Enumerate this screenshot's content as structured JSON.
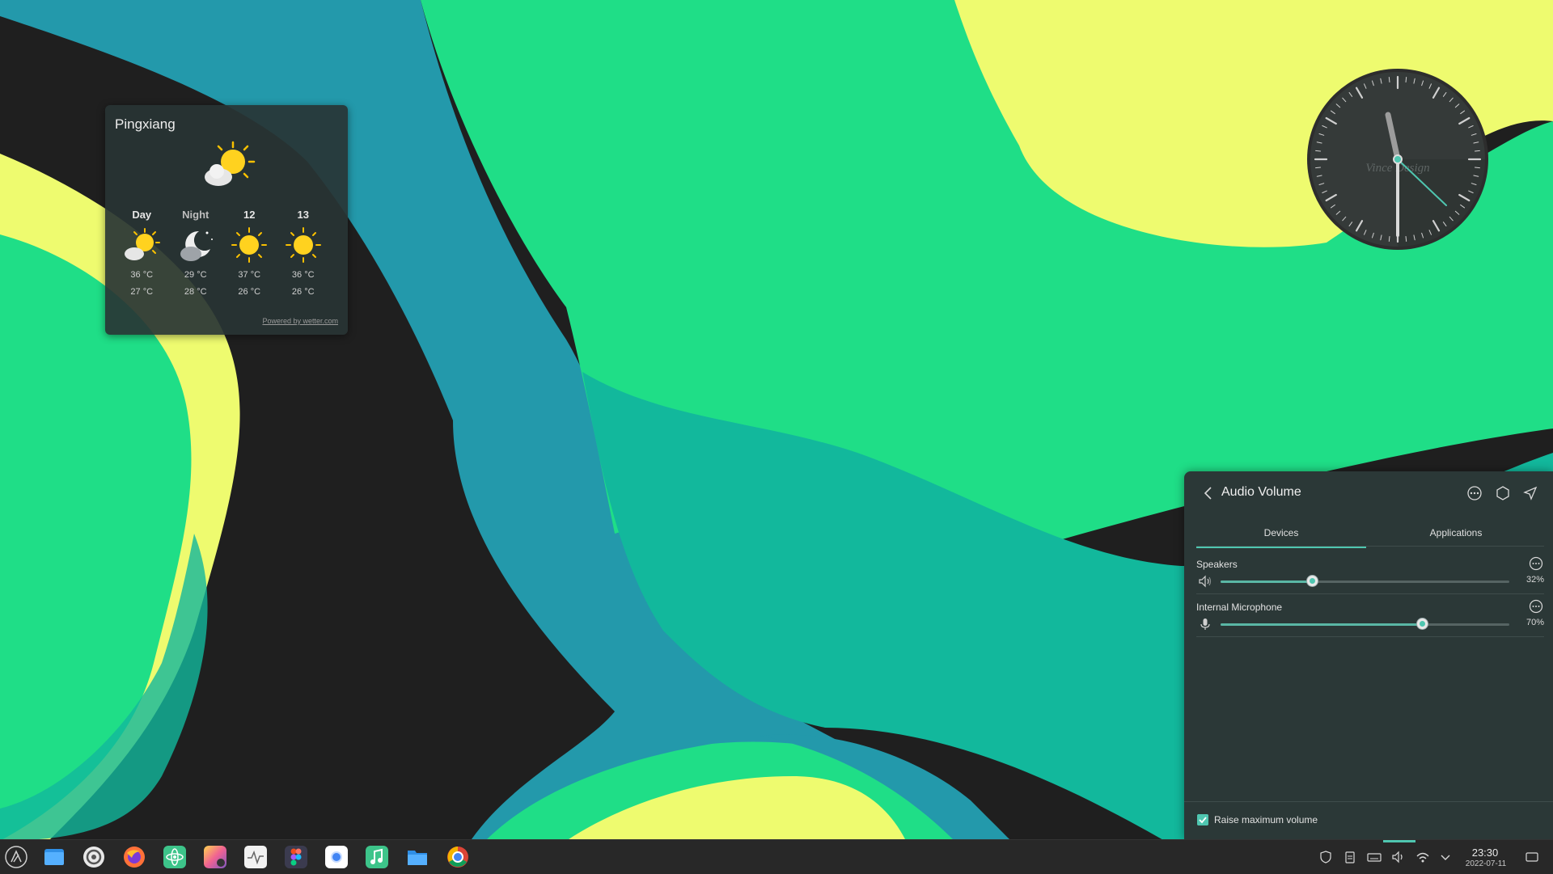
{
  "weather": {
    "city": "Pingxiang",
    "powered_by": "Powered by wetter.com",
    "forecast": [
      {
        "label": "Day",
        "high": "36 °C",
        "low": "27 °C",
        "icon": "partly-sunny-icon"
      },
      {
        "label": "Night",
        "high": "29 °C",
        "low": "28 °C",
        "icon": "moon-cloud-icon"
      },
      {
        "label": "12",
        "high": "37 °C",
        "low": "26 °C",
        "icon": "sun-icon"
      },
      {
        "label": "13",
        "high": "36 °C",
        "low": "26 °C",
        "icon": "sun-icon"
      }
    ]
  },
  "clock": {
    "brand": "Vince Design",
    "time": "23:30"
  },
  "audio": {
    "title": "Audio Volume",
    "tabs": {
      "devices": "Devices",
      "applications": "Applications"
    },
    "devices": [
      {
        "name": "Speakers",
        "percent_label": "32%",
        "level": 0.32,
        "icon": "speaker-icon"
      },
      {
        "name": "Internal Microphone",
        "percent_label": "70%",
        "level": 0.7,
        "icon": "microphone-icon"
      }
    ],
    "raise_max_label": "Raise maximum volume",
    "raise_max_checked": true
  },
  "taskbar": {
    "time": "23:30",
    "date": "2022-07-11",
    "apps": [
      "launcher-icon",
      "file-manager-icon",
      "settings-icon",
      "firefox-icon",
      "atom-icon",
      "image-viewer-icon",
      "system-monitor-icon",
      "figma-icon",
      "chromium-icon",
      "music-icon",
      "folder-icon",
      "chrome-icon"
    ],
    "tray": [
      "security-icon",
      "clipboard-icon",
      "keyboard-icon",
      "volume-icon",
      "wifi-icon",
      "chevron-up-icon",
      "desktop-icon"
    ]
  },
  "colors": {
    "accent": "#4fc6b0",
    "wall_green": "#1fde87",
    "wall_yellow": "#eefb6f",
    "wall_teal": "#12b89c",
    "wall_blue": "#2399ab",
    "panel_bg": "#2b3837"
  }
}
